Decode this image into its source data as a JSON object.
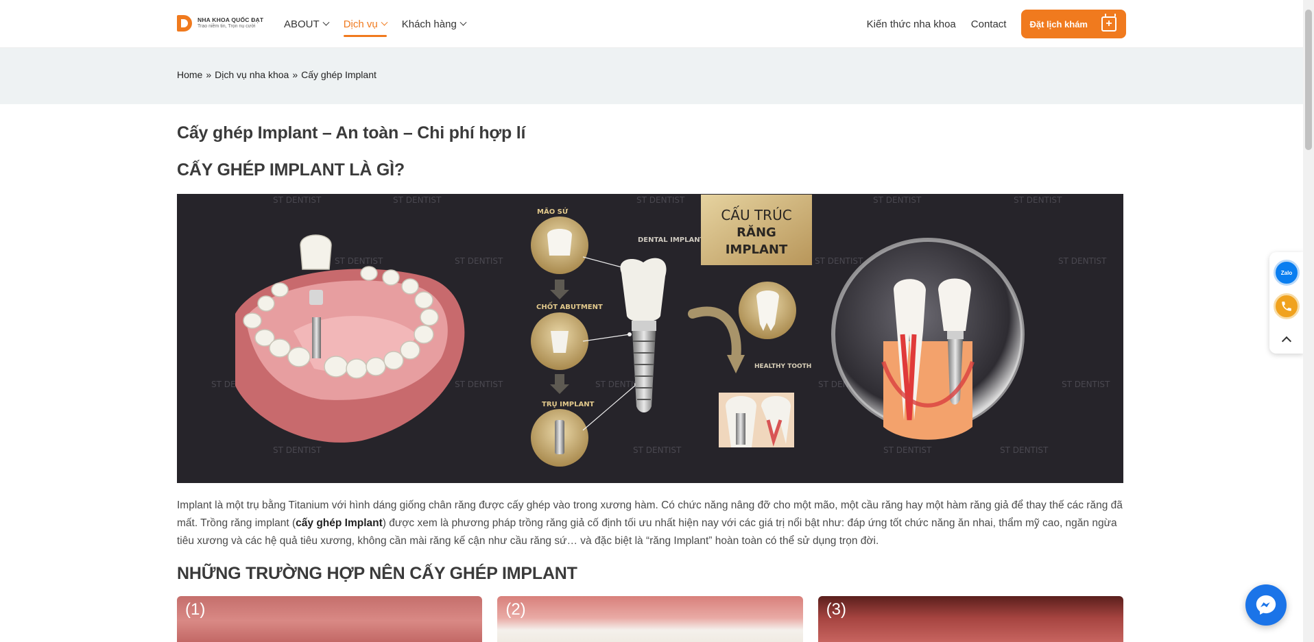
{
  "header": {
    "logo": {
      "name": "NHA KHOA QUỐC ĐẠT",
      "tagline": "Trao niềm tin, Trọn nụ cười"
    },
    "nav": [
      {
        "label": "ABOUT",
        "has_dropdown": true,
        "active": false
      },
      {
        "label": "Dịch vụ",
        "has_dropdown": true,
        "active": true
      },
      {
        "label": "Khách hàng",
        "has_dropdown": true,
        "active": false
      }
    ],
    "right_links": [
      "Kiến thức nha khoa",
      "Contact"
    ],
    "book_button": "Đặt lịch khám",
    "accent_color": "#f07a1e"
  },
  "breadcrumb": {
    "items": [
      "Home",
      "Dịch vụ nha khoa",
      "Cấy ghép Implant"
    ],
    "separator": "»"
  },
  "content": {
    "title": "Cấy ghép Implant – An toàn – Chi phí hợp lí",
    "section1_heading": "CẤY GHÉP IMPLANT LÀ GÌ?",
    "hero": {
      "watermark": "ST DENTIST",
      "labels": {
        "crown": "MÃO SỨ",
        "abutment": "CHỐT ABUTMENT",
        "implant": "TRỤ IMPLANT",
        "dental_implant": "DENTAL IMPLANT",
        "structure_1": "CẤU TRÚC",
        "structure_2": "RĂNG",
        "structure_3": "IMPLANT",
        "healthy_tooth": "HEALTHY TOOTH"
      }
    },
    "paragraph": {
      "part1": "Implant là một trụ bằng Titanium với hình dáng giống chân răng được cấy ghép vào trong xương hàm. Có chức năng nâng đỡ cho một mão, một cầu răng hay một hàm răng giả để thay thế các răng đã mất. Trồng răng implant (",
      "bold": "cấy ghép Implant",
      "part2": ") được xem là phương pháp trồng răng giả cố định tối ưu nhất hiện nay với các giá trị nổi bật như: đáp ứng tốt chức năng ăn nhai, thẩm mỹ cao, ngăn ngừa tiêu xương và các hệ quả tiêu xương, không cần mài răng kế cận như cầu răng sứ… và đặc biệt là “răng Implant” hoàn toàn có thể sử dụng trọn đời."
    },
    "section2_heading": "NHỮNG TRƯỜNG HỢP NÊN CẤY GHÉP IMPLANT",
    "cases": [
      "(1)",
      "(2)",
      "(3)"
    ]
  },
  "floating": {
    "zalo": "Zalo"
  }
}
